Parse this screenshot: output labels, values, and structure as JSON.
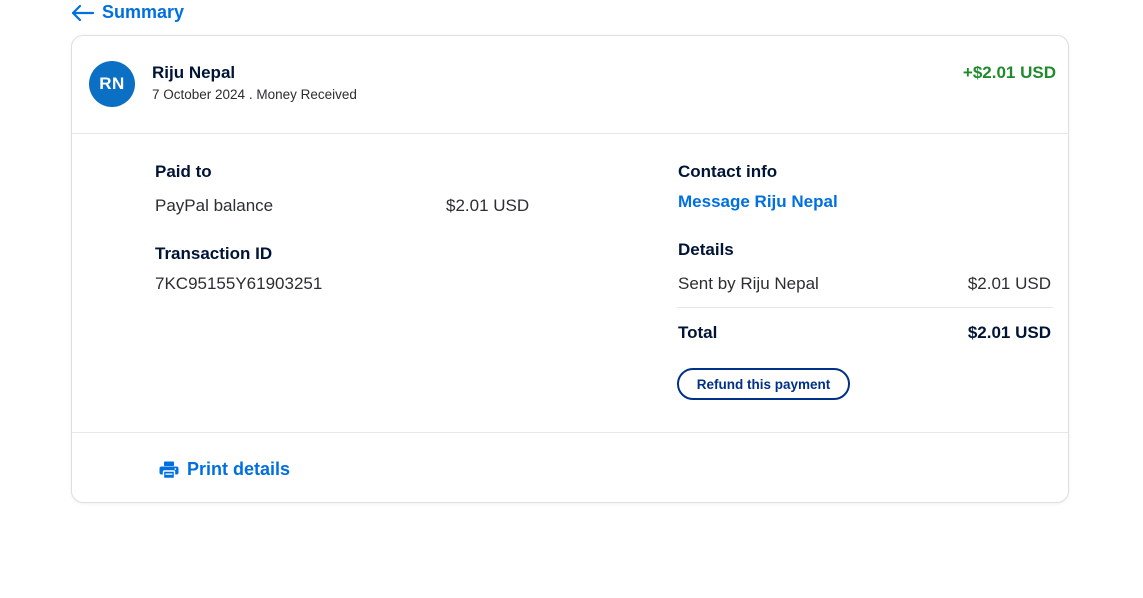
{
  "nav": {
    "back_label": "Summary"
  },
  "header": {
    "avatar_initials": "RN",
    "name": "Riju Nepal",
    "date": "7 October 2024",
    "separator": " . ",
    "type": "Money Received",
    "amount": "+$2.01 USD"
  },
  "paid_to": {
    "title": "Paid to",
    "method": "PayPal balance",
    "amount": "$2.01 USD"
  },
  "transaction": {
    "title": "Transaction ID",
    "id": "7KC95155Y61903251"
  },
  "contact": {
    "title": "Contact info",
    "message_link": "Message Riju Nepal"
  },
  "details": {
    "title": "Details",
    "line_label": "Sent by Riju Nepal",
    "line_amount": "$2.01 USD",
    "total_label": "Total",
    "total_amount": "$2.01 USD"
  },
  "actions": {
    "refund_label": "Refund this payment",
    "print_label": "Print details"
  },
  "colors": {
    "accent": "#0070e0",
    "positive": "#208a2e",
    "avatar_bg": "#0b6fc4",
    "button_border": "#003087"
  },
  "icons": {
    "back": "arrow-left-icon",
    "print": "printer-icon"
  }
}
